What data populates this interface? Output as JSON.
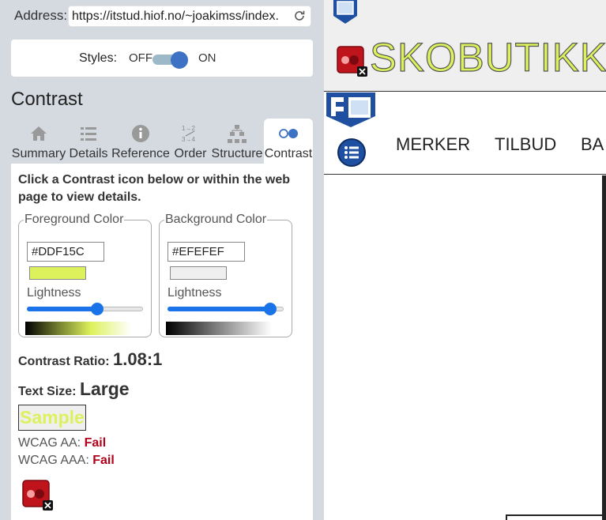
{
  "address_bar": {
    "label": "Address:",
    "url": "https://itstud.hiof.no/~joakimss/index."
  },
  "styles_toggle": {
    "label": "Styles:",
    "off": "OFF",
    "on": "ON",
    "state": "on"
  },
  "section_title": "Contrast",
  "tabs": [
    {
      "label": "Summary",
      "icon": "home-icon"
    },
    {
      "label": "Details",
      "icon": "list-icon"
    },
    {
      "label": "Reference",
      "icon": "info-icon"
    },
    {
      "label": "Order",
      "icon": "order-icon"
    },
    {
      "label": "Structure",
      "icon": "structure-icon"
    },
    {
      "label": "Contrast",
      "icon": "contrast-icon",
      "active": true
    }
  ],
  "instructions": "Click a Contrast icon below or within the web page to view details.",
  "foreground": {
    "legend": "Foreground Color",
    "hex": "#DDF15C",
    "lightness_label": "Lightness",
    "lightness": 0.62
  },
  "background": {
    "legend": "Background Color",
    "hex": "#EFEFEF",
    "lightness_label": "Lightness",
    "lightness": 0.93
  },
  "contrast_ratio": {
    "label": "Contrast Ratio:",
    "value": "1.08:1"
  },
  "text_size": {
    "label": "Text Size:",
    "value": "Large"
  },
  "sample": "Sample",
  "wcag": {
    "aa": {
      "label": "WCAG AA:",
      "result": "Fail"
    },
    "aaa": {
      "label": "WCAG AAA:",
      "result": "Fail"
    }
  },
  "page": {
    "title": "SKOBUTIKK",
    "nav": [
      "MERKER",
      "TILBUD",
      "BA"
    ]
  },
  "colors": {
    "accent": "#3c71c4",
    "fail": "#b3001b",
    "foreground": "#ddf15c",
    "background": "#efefef"
  }
}
